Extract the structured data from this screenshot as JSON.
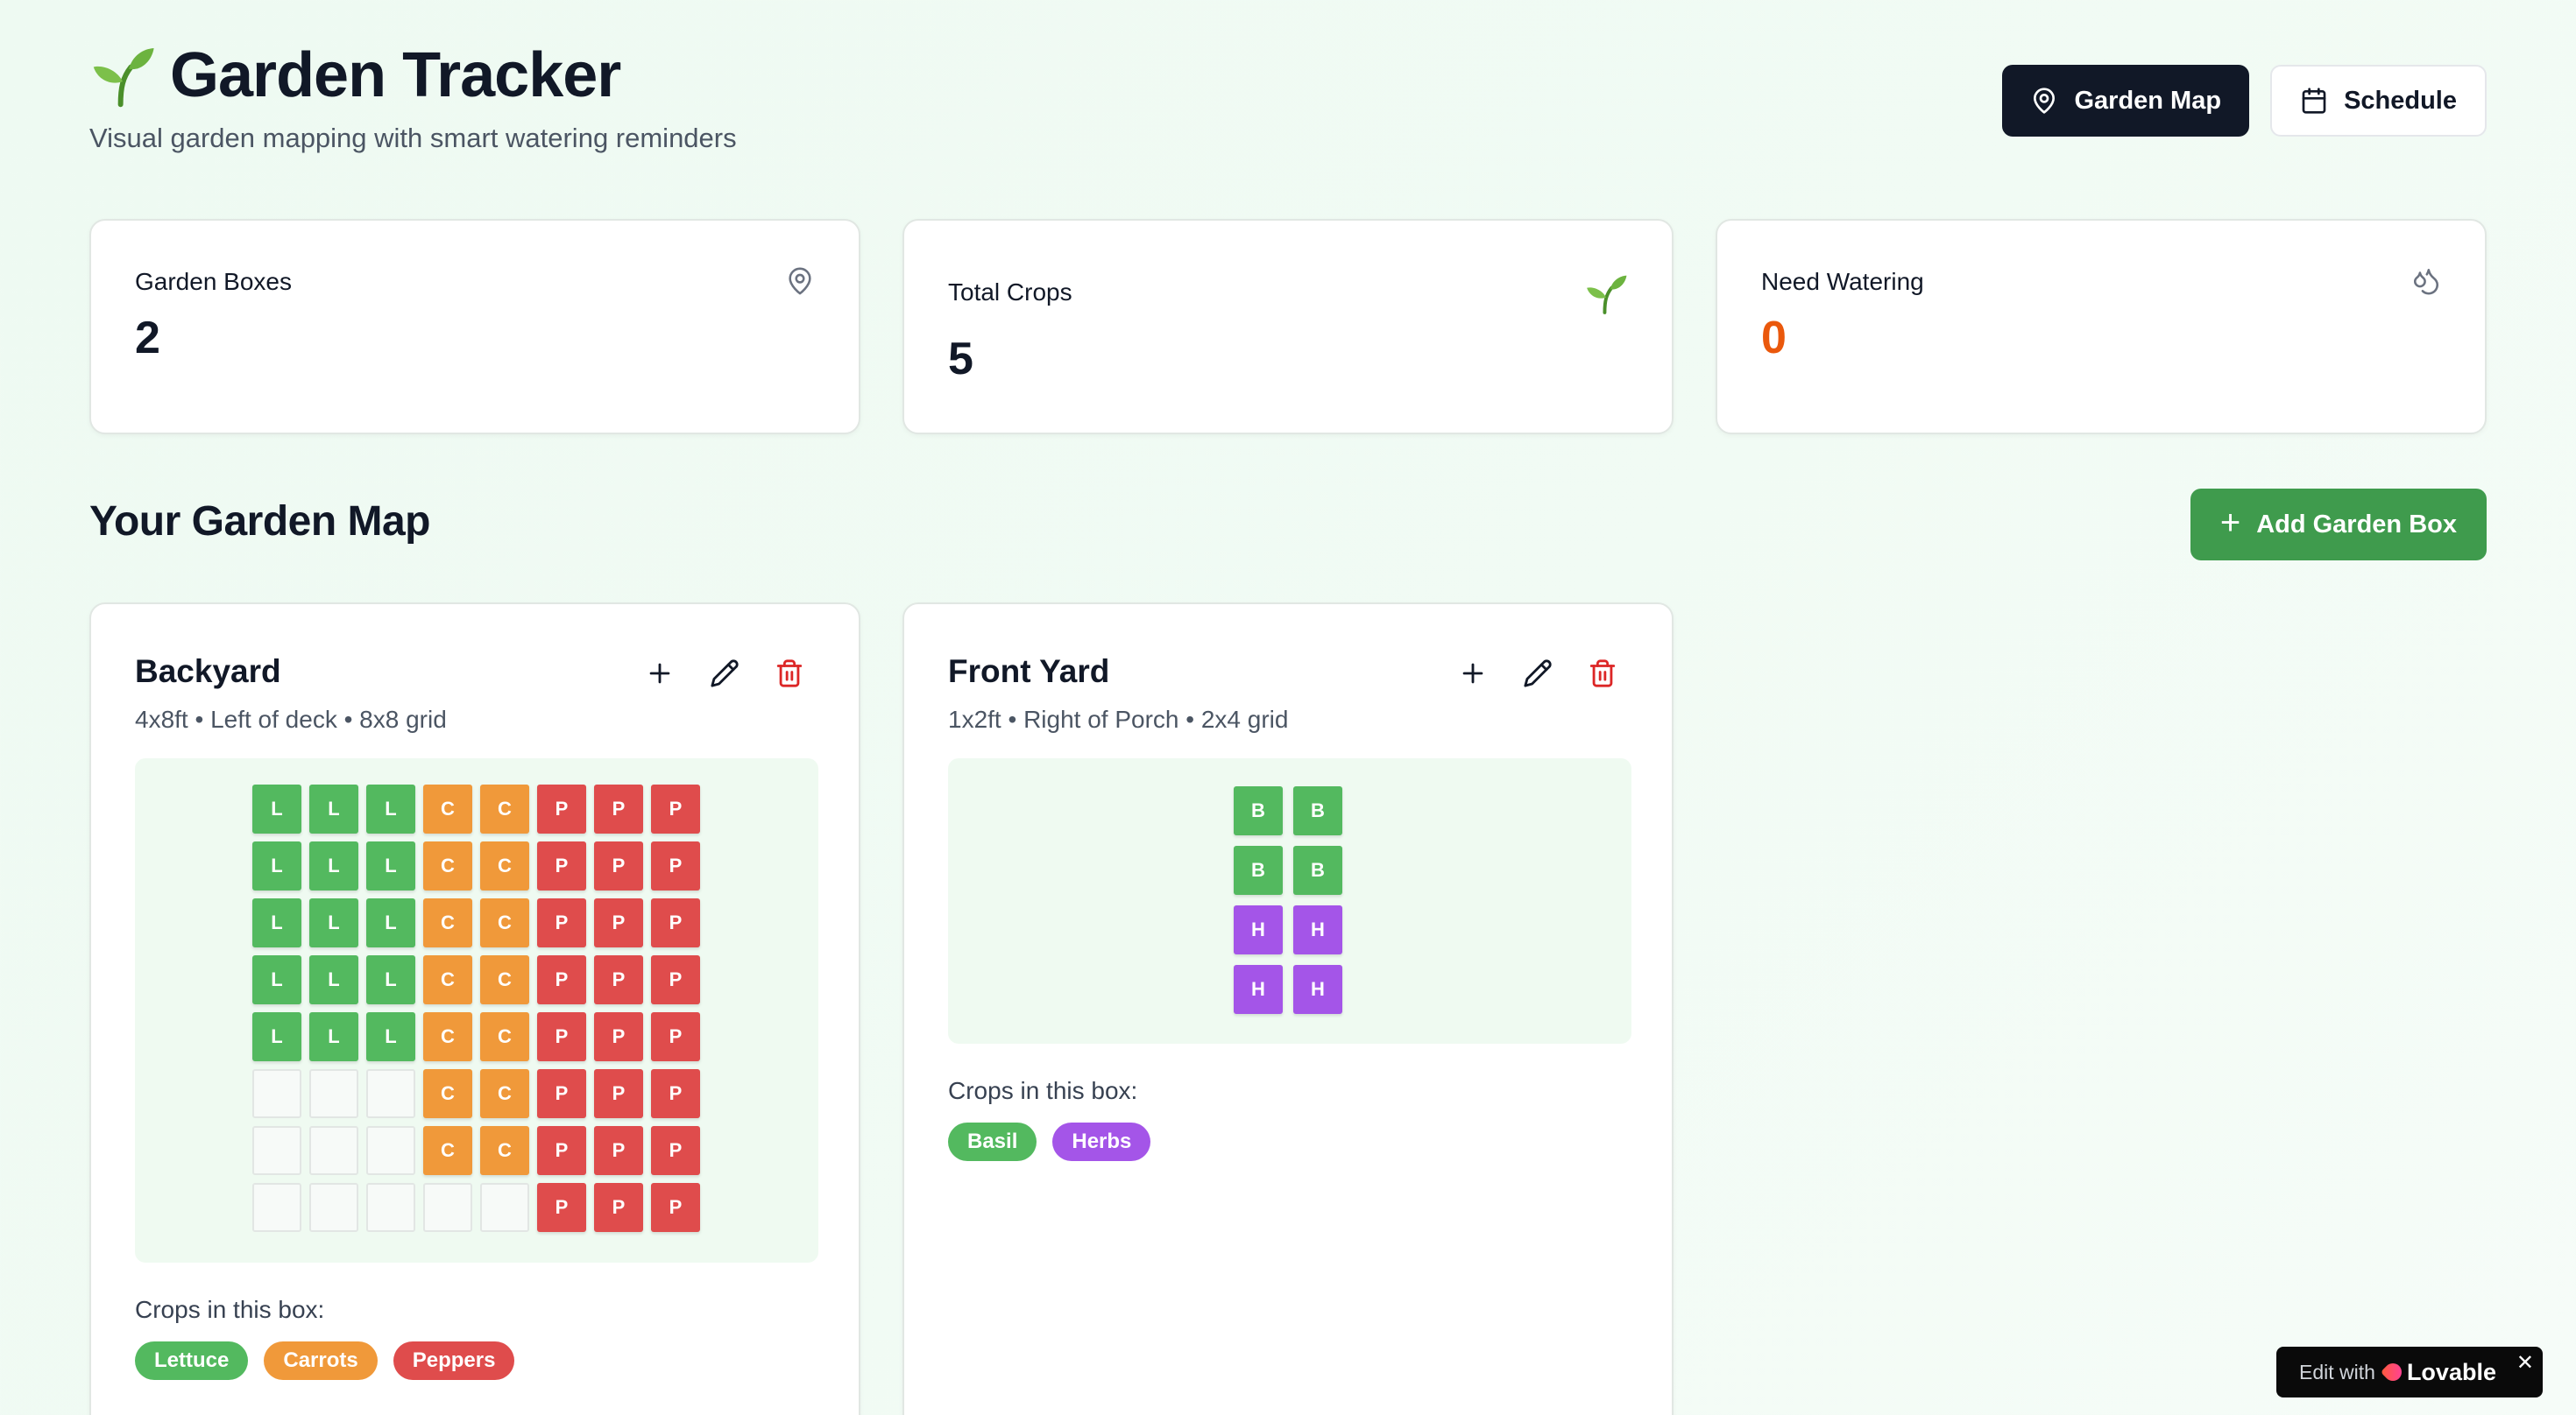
{
  "header": {
    "title": "Garden Tracker",
    "subtitle": "Visual garden mapping with smart watering reminders",
    "garden_map_label": "Garden Map",
    "schedule_label": "Schedule"
  },
  "stats": {
    "garden_boxes": {
      "label": "Garden Boxes",
      "value": "2",
      "icon": "map-pin-icon"
    },
    "total_crops": {
      "label": "Total Crops",
      "value": "5",
      "icon": "sprout-icon"
    },
    "need_watering": {
      "label": "Need Watering",
      "value": "0",
      "icon": "droplets-icon",
      "color": "#ea580c"
    }
  },
  "section": {
    "title": "Your Garden Map",
    "add_box_label": "Add Garden Box"
  },
  "colors": {
    "lettuce": "#53b95f",
    "carrots": "#f0993a",
    "peppers": "#df4c4c",
    "basil": "#53b95f",
    "herbs": "#a455e8",
    "accent_green": "#3f9b4d",
    "danger": "#dc2626"
  },
  "boxes": [
    {
      "name": "Backyard",
      "meta": "4x8ft • Left of deck • 8x8 grid",
      "crops_label": "Crops in this box:",
      "grid": [
        [
          "L",
          "L",
          "L",
          "C",
          "C",
          "P",
          "P",
          "P"
        ],
        [
          "L",
          "L",
          "L",
          "C",
          "C",
          "P",
          "P",
          "P"
        ],
        [
          "L",
          "L",
          "L",
          "C",
          "C",
          "P",
          "P",
          "P"
        ],
        [
          "L",
          "L",
          "L",
          "C",
          "C",
          "P",
          "P",
          "P"
        ],
        [
          "L",
          "L",
          "L",
          "C",
          "C",
          "P",
          "P",
          "P"
        ],
        [
          "",
          "",
          "",
          "C",
          "C",
          "P",
          "P",
          "P"
        ],
        [
          "",
          "",
          "",
          "C",
          "C",
          "P",
          "P",
          "P"
        ],
        [
          "",
          "",
          "",
          "",
          "",
          "P",
          "P",
          "P"
        ]
      ],
      "crops": [
        "Lettuce",
        "Carrots",
        "Peppers"
      ]
    },
    {
      "name": "Front Yard",
      "meta": "1x2ft • Right of Porch • 2x4 grid",
      "crops_label": "Crops in this box:",
      "grid": [
        [
          "B",
          "B"
        ],
        [
          "B",
          "B"
        ],
        [
          "H",
          "H"
        ],
        [
          "H",
          "H"
        ]
      ],
      "crops": [
        "Basil",
        "Herbs"
      ]
    }
  ],
  "lovable": {
    "edit_with": "Edit with",
    "brand": "Lovable",
    "close": "✕"
  }
}
